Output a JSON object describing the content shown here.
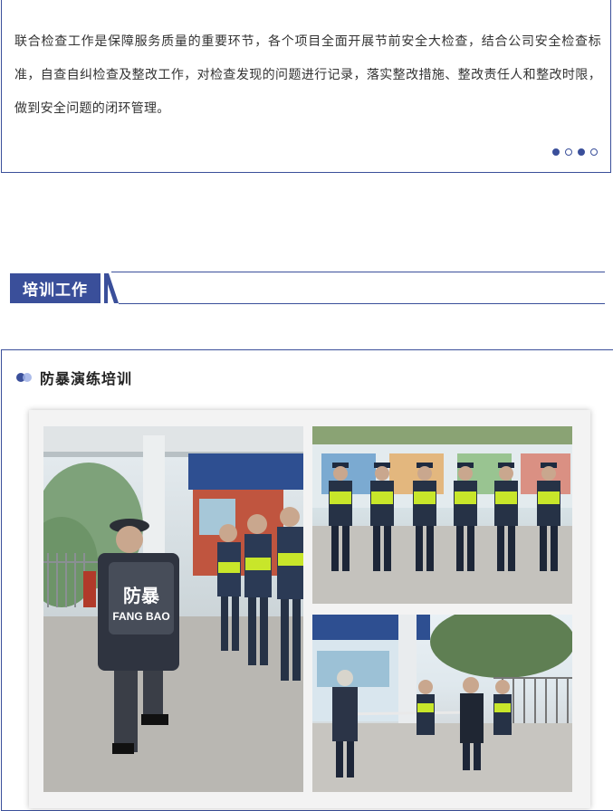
{
  "intro": {
    "paragraph": "联合检查工作是保障服务质量的重要环节，各个项目全面开展节前安全大检查，结合公司安全检查标准，自查自纠检查及整改工作，对检查发现的问题进行记录，落实整改措施、整改责任人和整改时限，做到安全问题的闭环管理。",
    "pagination": {
      "total": 4,
      "active": [
        0,
        2
      ]
    }
  },
  "section": {
    "title": "培训工作"
  },
  "training": {
    "subtitle": "防暴演练培训",
    "photo_a": {
      "shield_text_cn": "防暴",
      "shield_text_en": "FANG BAO"
    }
  },
  "colors": {
    "accent": "#3a4f9a",
    "accent_light": "#9fb0e6",
    "vest": "#c8e62a"
  }
}
